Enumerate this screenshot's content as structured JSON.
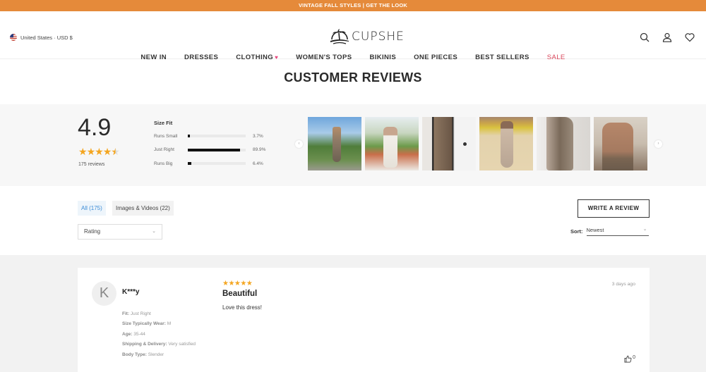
{
  "promo": {
    "text": "VINTAGE FALL STYLES | GET THE LOOK"
  },
  "header": {
    "locale": "United States · USD $",
    "logo_text": "CUPSHE",
    "icons": [
      "search-icon",
      "account-icon",
      "wishlist-heart-icon"
    ]
  },
  "nav": {
    "items": [
      {
        "label": "NEW IN"
      },
      {
        "label": "DRESSES"
      },
      {
        "label": "CLOTHING",
        "badge": "♥"
      },
      {
        "label": "WOMEN'S TOPS"
      },
      {
        "label": "BIKINIS"
      },
      {
        "label": "ONE PIECES"
      },
      {
        "label": "BEST SELLERS"
      },
      {
        "label": "SALE",
        "color": "#d9455a"
      }
    ]
  },
  "page": {
    "title": "CUSTOMER REVIEWS"
  },
  "summary": {
    "average": "4.9",
    "stars": "★★★★⯪",
    "star_rating": 4.9,
    "reviews_count": "175 reviews",
    "size_fit": {
      "title": "Size Fit",
      "rows": [
        {
          "label": "Runs Small",
          "percent": 3.7,
          "percent_text": "3.7%"
        },
        {
          "label": "Just Right",
          "percent": 89.9,
          "percent_text": "89.9%"
        },
        {
          "label": "Runs Big",
          "percent": 6.4,
          "percent_text": "6.4%"
        }
      ]
    },
    "gallery": {
      "prev_icon": "‹",
      "next_icon": "›",
      "photos": [
        {
          "alt": "customer photo 1 - long dress tropical garden"
        },
        {
          "alt": "customer photo 2 - white cover-up with cap"
        },
        {
          "alt": "customer photo 3 - mirror selfie in doorway"
        },
        {
          "alt": "customer photo 4 - sequin maxi dress"
        },
        {
          "alt": "customer photo 5 - sequin dress side view"
        },
        {
          "alt": "customer photo 6 - backless dress mirror selfie"
        }
      ]
    }
  },
  "filters": {
    "tabs": [
      {
        "label": "All (175)",
        "active": true
      },
      {
        "label": "Images & Videos (22)",
        "active": false
      }
    ],
    "rating_select": {
      "value": "Rating",
      "chevron": "⌄"
    },
    "write_review": "WRITE A REVIEW",
    "sort": {
      "label": "Sort:",
      "value": "Newest",
      "chevron": "⌄"
    }
  },
  "reviews": [
    {
      "avatar_letter": "K",
      "name": "K***y",
      "stars": "★★★★★",
      "rating": 5,
      "title": "Beautiful",
      "body": "Love this dress!",
      "date": "3 days ago",
      "helpful_count": "0",
      "attributes": [
        {
          "label": "Fit:",
          "value": "Just Right"
        },
        {
          "label": "Size Typically Wear:",
          "value": "M"
        },
        {
          "label": "Age:",
          "value": "35-44"
        },
        {
          "label": "Shipping & Delivery:",
          "value": "Very satisfied"
        },
        {
          "label": "Body Type:",
          "value": "Slender"
        }
      ]
    }
  ],
  "colors": {
    "promo_bg": "#e58a3a",
    "star": "#f4a621",
    "sale": "#d9455a",
    "active_tab_text": "#3a8bd6"
  }
}
